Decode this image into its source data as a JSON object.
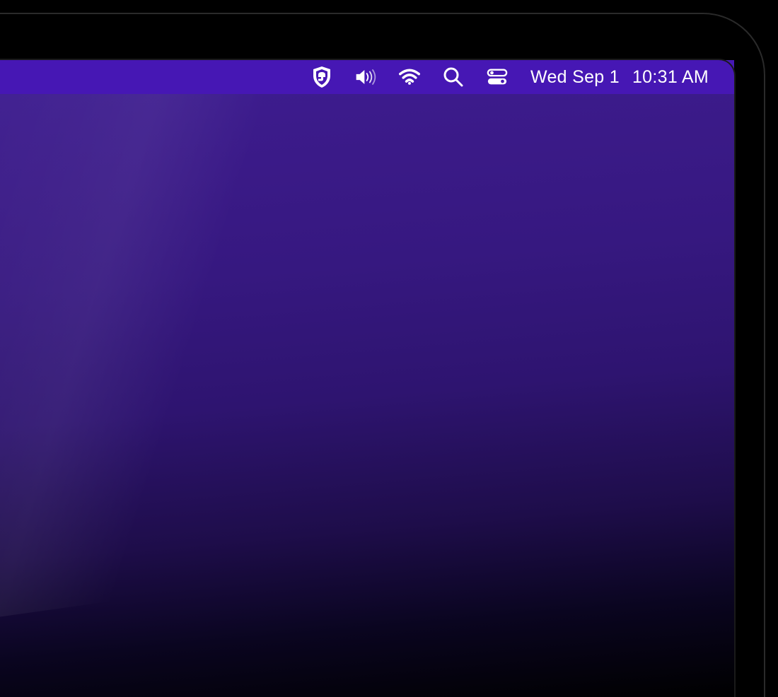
{
  "menubar": {
    "app_icon_name": "guardian-shield-icon",
    "volume_icon_name": "volume-icon",
    "wifi_icon_name": "wifi-icon",
    "search_icon_name": "spotlight-search-icon",
    "control_center_icon_name": "control-center-icon",
    "date": "Wed Sep 1",
    "time": "10:31 AM"
  },
  "colors": {
    "menubar_bg": "#4617B4",
    "menubar_fg": "#FFFFFF",
    "wallpaper_top": "#3d1c8f",
    "wallpaper_bottom": "#000000"
  }
}
